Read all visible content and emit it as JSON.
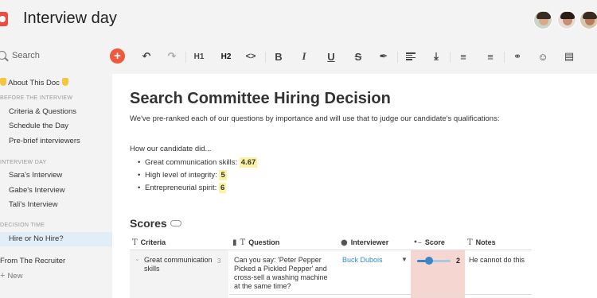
{
  "header": {
    "title": "Interview day",
    "avatars": [
      "user-1",
      "user-2",
      "user-3"
    ]
  },
  "sidebar": {
    "search_label": "Search",
    "about": "About This Doc",
    "sections": [
      {
        "label": "BEFORE THE INTERVIEW",
        "items": [
          "Criteria & Questions",
          "Schedule the Day",
          "Pre-brief interviewers"
        ]
      },
      {
        "label": "INTERVIEW DAY",
        "items": [
          "Sara's Interview",
          "Gabe's Interview",
          "Tali's Interview"
        ]
      },
      {
        "label": "DECISION TIME",
        "items": [
          "Hire or No Hire?"
        ]
      }
    ],
    "recruiter": "From The Recruiter",
    "new_label": "New",
    "active_item": "Hire or No Hire?"
  },
  "toolbar": {
    "buttons": [
      "add",
      "undo",
      "redo",
      "heading-1",
      "heading-2",
      "code",
      "bold",
      "italic",
      "underline",
      "strikethrough",
      "highlight",
      "align",
      "text-bottom",
      "bulleted-list",
      "numbered-list",
      "link",
      "emoji",
      "comment"
    ],
    "h1": "H1",
    "h2": "H2",
    "code": "<>",
    "bold": "B",
    "italic": "I",
    "underline": "U",
    "strike": "S"
  },
  "doc": {
    "title": "Search Committee Hiring Decision",
    "intro": "We've pre-ranked each of our questions by importance and will use that to judge our candidate's qualifications:",
    "subheading": "How our candidate did...",
    "bullets": [
      {
        "label": "Great communication skills:",
        "value": "4.67"
      },
      {
        "label": "High level of integrity:",
        "value": "5"
      },
      {
        "label": "Entrepreneurial spirit:",
        "value": "6"
      }
    ],
    "scores_heading": "Scores"
  },
  "table": {
    "columns": [
      "Criteria",
      "Question",
      "Interviewer",
      "Score",
      "Notes"
    ],
    "rows": [
      {
        "criteria": "Great communication skills",
        "criteria_count": "3",
        "question": "Can you say: 'Peter Pepper Picked a Pickled Pepper' and cross-sell a washing machine at the same time?",
        "interviewer": "Buck Dubois",
        "score": "2",
        "score_fraction": 0.35,
        "notes": "He cannot do this"
      }
    ]
  },
  "colors": {
    "accent": "#ef5a3c",
    "link": "#2e8bd0",
    "highlight": "#fdf1a2",
    "score_bg": "#f6d6d0",
    "active_nav": "#e1edf7"
  }
}
